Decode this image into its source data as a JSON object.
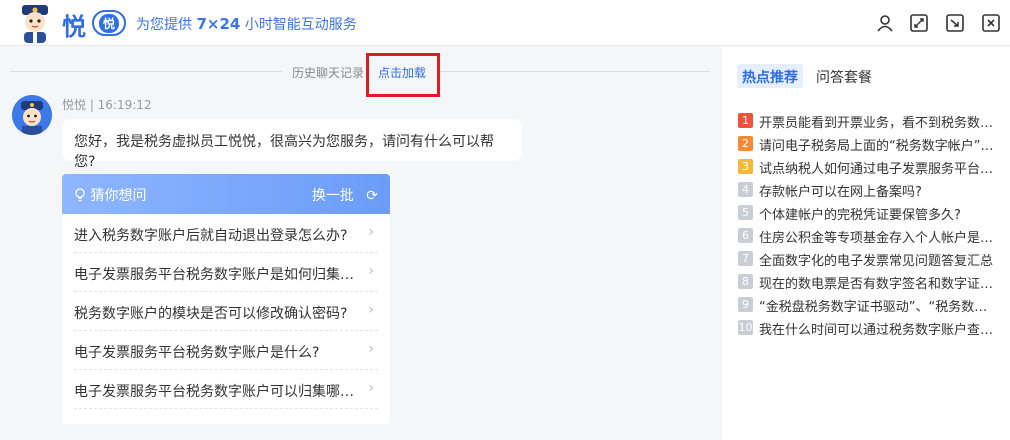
{
  "header": {
    "brand": "悦",
    "badge": "悦",
    "slogan_pre": "为您提供 ",
    "slogan_bold": "7×24",
    "slogan_post": " 小时智能互动服务",
    "icons": [
      "user-icon",
      "expand-icon",
      "export-icon",
      "close-icon"
    ]
  },
  "chat": {
    "history_text": "历史聊天记录",
    "load_text": "点击加载",
    "sender_meta": "悦悦 | 16:19:12",
    "greeting": "您好，我是税务虚拟员工悦悦，很高兴为您服务，请问有什么可以帮您?",
    "guess": {
      "title": "猜你想问",
      "refresh": "换一批",
      "items": [
        "进入税务数字账户后就自动退出登录怎么办?",
        "电子发票服务平台税务数字账户是如何归集发票的？",
        "税务数字账户的模块是否可以修改确认密码?",
        "电子发票服务平台税务数字账户是什么?",
        "电子发票服务平台税务数字账户可以归集哪些发票？"
      ]
    }
  },
  "side": {
    "tab_active": "热点推荐",
    "tab_other": "问答套餐",
    "hot_items": [
      {
        "num": "1",
        "text": "开票员能看到开票业务，看不到税务数字账户怎么办？"
      },
      {
        "num": "2",
        "text": "请问电子税务局上面的“税务数字帐户”在哪里？"
      },
      {
        "num": "3",
        "text": "试点纳税人如何通过电子发票服务平台开具发票？"
      },
      {
        "num": "4",
        "text": "存款帐户可以在网上备案吗?"
      },
      {
        "num": "5",
        "text": "个体建帐户的完税凭证要保管多久?"
      },
      {
        "num": "6",
        "text": "住房公积金等专项基金存入个人帐户是否缴纳个税？"
      },
      {
        "num": "7",
        "text": "全面数字化的电子发票常见问题答复汇总"
      },
      {
        "num": "8",
        "text": "现在的数电票是否有数字签名和数字证书？"
      },
      {
        "num": "9",
        "text": "“金税盘税务数字证书驱动”、“税务数字证书”"
      },
      {
        "num": "10",
        "text": "我在什么时间可以通过税务数字账户查询发票？"
      }
    ],
    "num_colors": {
      "1": "#f0523a",
      "2": "#f58a34",
      "3": "#f5b93a",
      "rest": "#c8cdd6"
    }
  }
}
